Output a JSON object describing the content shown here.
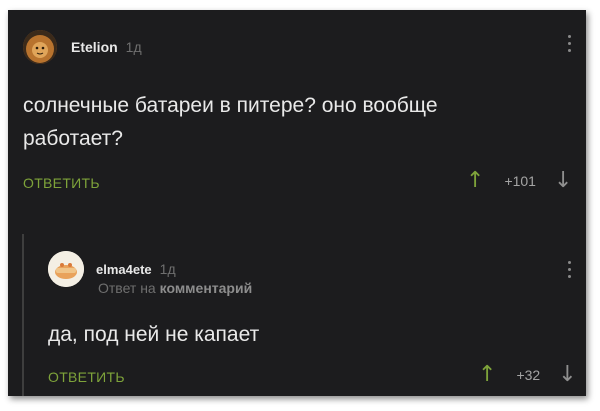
{
  "comment": {
    "author": "Etelion",
    "time": "1д",
    "text_line1": "солнечные батареи в питере? оно вообще",
    "text_line2": "работает?",
    "reply_label": "ОТВЕТИТЬ",
    "votes": "+101",
    "icons": {
      "avatar": "lion-avatar-icon",
      "menu": "more-vertical-icon",
      "up": "arrow-up-icon",
      "down": "arrow-down-icon"
    }
  },
  "reply": {
    "author": "elma4ete",
    "time": "1д",
    "meta_prefix": "Ответ на",
    "meta_target": "комментарий",
    "text": "да, под ней не капает",
    "reply_label": "ОТВЕТИТЬ",
    "votes": "+32",
    "icons": {
      "avatar": "cartoon-avatar-icon",
      "menu": "more-vertical-icon",
      "up": "arrow-up-icon",
      "down": "arrow-down-icon"
    }
  },
  "colors": {
    "background": "#1c1c1e",
    "accent_green": "#7ea33a",
    "text": "#e9e9e9",
    "muted": "#6f6f6f"
  }
}
